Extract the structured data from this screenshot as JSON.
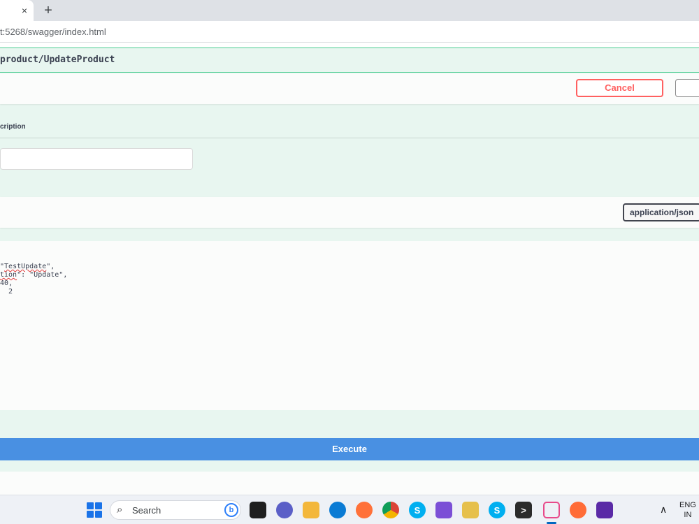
{
  "browser": {
    "tab_close": "×",
    "new_tab": "+",
    "url": "t:5268/swagger/index.html"
  },
  "operation": {
    "path": "product/UpdateProduct",
    "cancel_label": "Cancel",
    "param_label": "cription",
    "content_type": "application/json",
    "body_lines": {
      "l1_pre": "\"",
      "l1_word": "TestUpdate",
      "l1_post": "\",",
      "l2_word": "tion",
      "l2_post": "\": \"Update\",",
      "l3": "40,",
      "l4": "  2"
    },
    "execute_label": "Execute"
  },
  "taskbar": {
    "search_label": "Search",
    "language": "ENG\nIN",
    "icons": [
      "windows-start-icon",
      "search-icon",
      "bing-icon",
      "task-view-icon",
      "chat-icon",
      "file-explorer-icon",
      "edge-icon",
      "firefox-icon",
      "chrome-icon",
      "skype-icon",
      "visual-studio-icon",
      "dev-tool-icon",
      "skype-icon",
      "terminal-icon",
      "snipping-tool-icon",
      "postman-icon",
      "app-icon"
    ],
    "colors": {
      "edge": "#0a7bd4",
      "firefox": "#ff7139",
      "skype": "#00aff0",
      "visual_studio": "#7b4fd6",
      "postman": "#ff6c37",
      "terminal": "#2b2b2b"
    }
  }
}
